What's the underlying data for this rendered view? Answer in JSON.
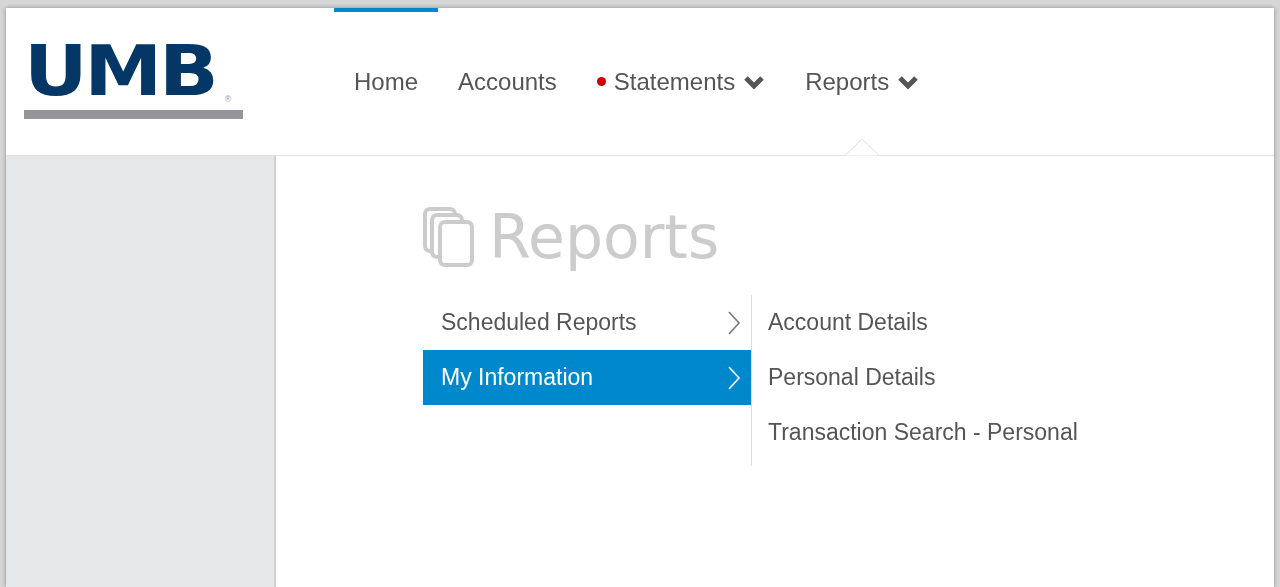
{
  "logo": {
    "text": "UMB",
    "mark": "®"
  },
  "nav": [
    {
      "label": "Home",
      "selected": true,
      "alert": false,
      "dropdown": false,
      "expanded": false
    },
    {
      "label": "Accounts",
      "selected": false,
      "alert": false,
      "dropdown": false,
      "expanded": false
    },
    {
      "label": "Statements",
      "selected": false,
      "alert": true,
      "dropdown": true,
      "expanded": false
    },
    {
      "label": "Reports",
      "selected": false,
      "alert": false,
      "dropdown": true,
      "expanded": true
    }
  ],
  "page_title": "Reports",
  "menu": [
    {
      "label": "Scheduled Reports",
      "selected": false
    },
    {
      "label": "My Information",
      "selected": true
    }
  ],
  "submenu": [
    {
      "label": "Account Details"
    },
    {
      "label": "Personal Details"
    },
    {
      "label": "Transaction Search - Personal"
    }
  ]
}
